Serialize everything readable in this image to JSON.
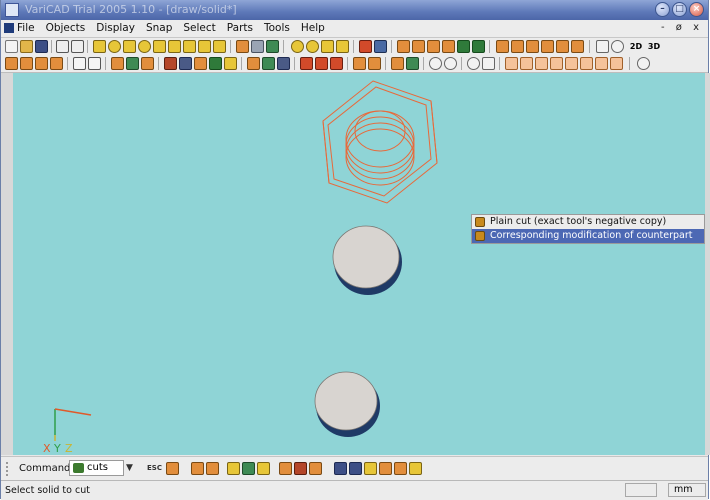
{
  "window": {
    "title": "VariCAD Trial 2005 1.10 - [draw/solid*]",
    "mdi_controls": "- ø x"
  },
  "menu": {
    "items": [
      "File",
      "Objects",
      "Display",
      "Snap",
      "Select",
      "Parts",
      "Tools",
      "Help"
    ]
  },
  "toolbar": {
    "view_2d_label": "2D",
    "view_3d_label": "3D"
  },
  "popup": {
    "items": [
      {
        "label": "Plain cut (exact tool's negative copy)",
        "selected": false
      },
      {
        "label": "Corresponding modification of counterpart",
        "selected": true
      }
    ]
  },
  "axes": {
    "x_label": "X",
    "y_label": "Y",
    "z_label": "Z",
    "colors": {
      "x": "#e05a2a",
      "y": "#2f9f4a",
      "z": "#c9b533"
    }
  },
  "command": {
    "label": "Command:",
    "value": "cuts",
    "esc_label": "ESC"
  },
  "status": {
    "message": "Select solid to cut",
    "units": "mm"
  },
  "colors": {
    "viewport": "#8fd4d6",
    "wireframe": "#e8693a",
    "solid_face": "#d8d4d0",
    "solid_edge": "#1f3a66",
    "titlebar": "#5d78b8",
    "selection": "#4c68b4"
  }
}
